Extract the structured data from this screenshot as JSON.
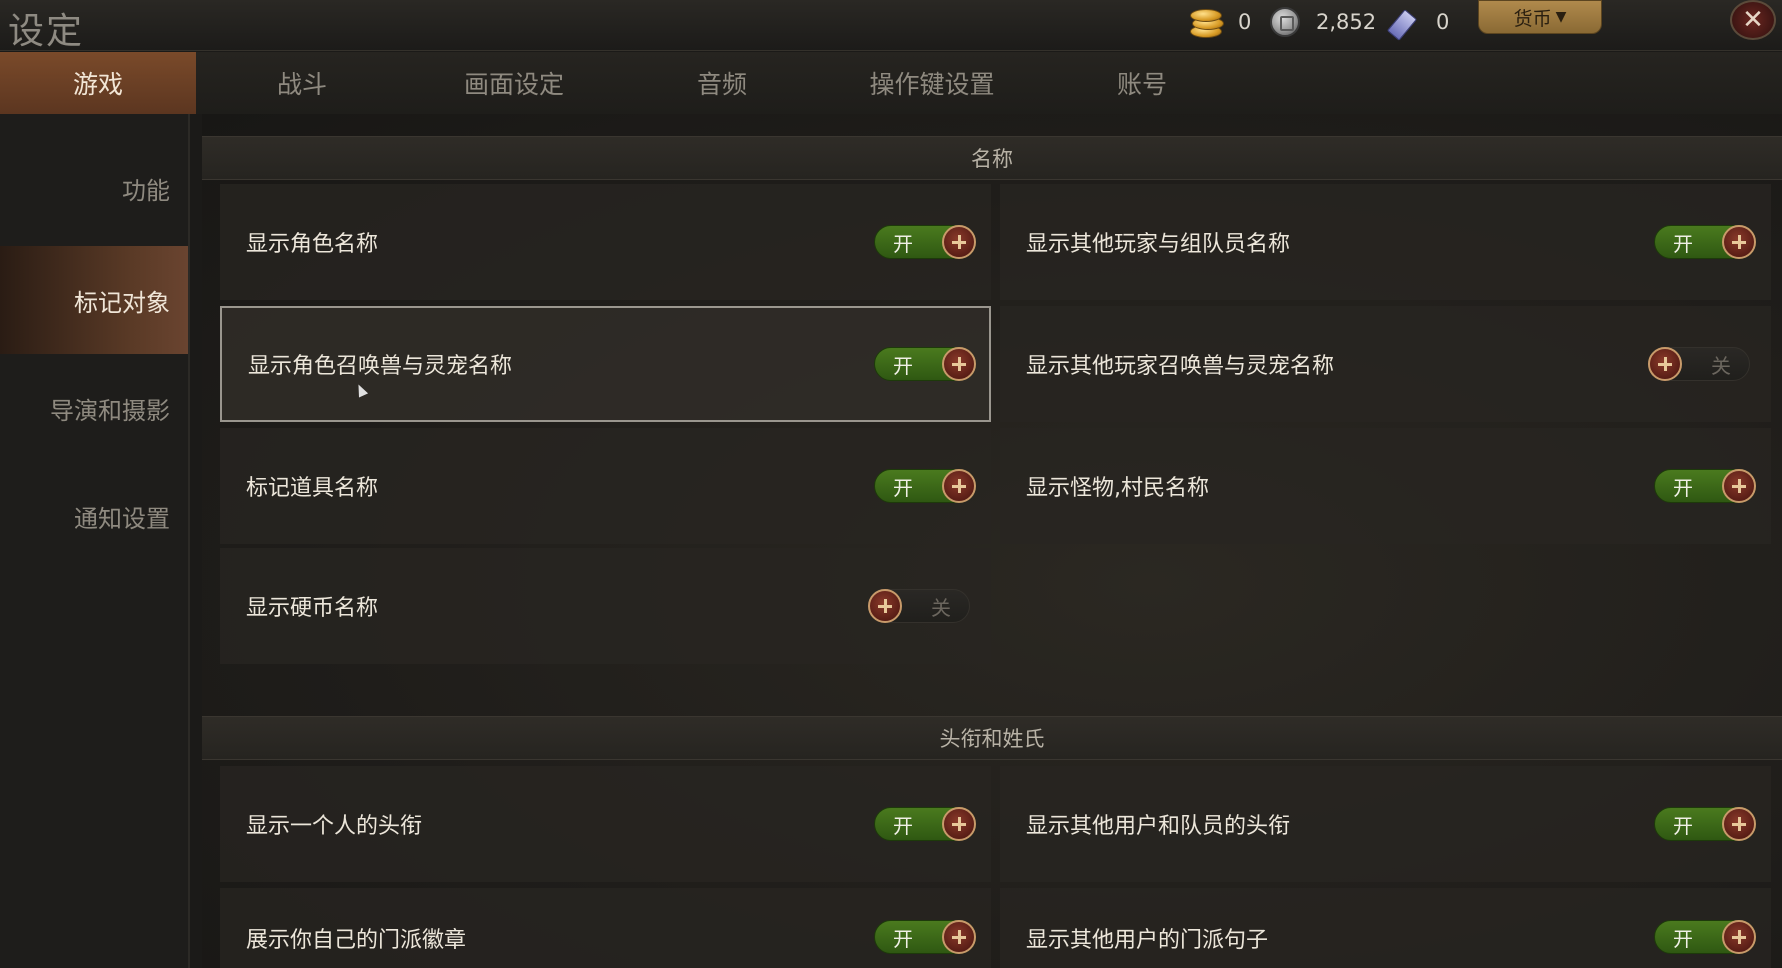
{
  "header": {
    "title": "设定",
    "currencies": [
      {
        "icon": "gold-coins-icon",
        "value": "0"
      },
      {
        "icon": "silver-coin-icon",
        "value": "2,852"
      },
      {
        "icon": "ticket-icon",
        "value": "0"
      }
    ],
    "currency_button": "货币",
    "currency_arrow": "▼",
    "close_glyph": "✕"
  },
  "tabs": [
    {
      "label": "游戏",
      "active": true
    },
    {
      "label": "战斗"
    },
    {
      "label": "画面设定"
    },
    {
      "label": "音频"
    },
    {
      "label": "操作键设置"
    },
    {
      "label": "账号"
    }
  ],
  "sidebar": {
    "items": [
      {
        "label": "功能"
      },
      {
        "label": "标记对象",
        "active": true
      },
      {
        "label": "导演和摄影"
      },
      {
        "label": "通知设置"
      }
    ]
  },
  "sections": [
    {
      "title": "名称",
      "rows": [
        {
          "label": "显示角色名称",
          "state": "开",
          "on": true
        },
        {
          "label": "显示其他玩家与组队员名称",
          "state": "开",
          "on": true
        },
        {
          "label": "显示角色召唤兽与灵宠名称",
          "state": "开",
          "on": true,
          "selected": true
        },
        {
          "label": "显示其他玩家召唤兽与灵宠名称",
          "state": "关",
          "on": false
        },
        {
          "label": "标记道具名称",
          "state": "开",
          "on": true
        },
        {
          "label": "显示怪物,村民名称",
          "state": "开",
          "on": true
        },
        {
          "label": "显示硬币名称",
          "state": "关",
          "on": false
        }
      ]
    },
    {
      "title": "头衔和姓氏",
      "rows": [
        {
          "label": "显示一个人的头衔",
          "state": "开",
          "on": true
        },
        {
          "label": "显示其他用户和队员的头衔",
          "state": "开",
          "on": true
        },
        {
          "label": "展示你自己的门派徽章",
          "state": "开",
          "on": true
        },
        {
          "label": "显示其他用户的门派句子",
          "state": "开",
          "on": true
        }
      ]
    }
  ],
  "colors": {
    "toggle_on": "#3e6a18",
    "toggle_off": "#24221f",
    "tab_active": "#6a4028"
  }
}
